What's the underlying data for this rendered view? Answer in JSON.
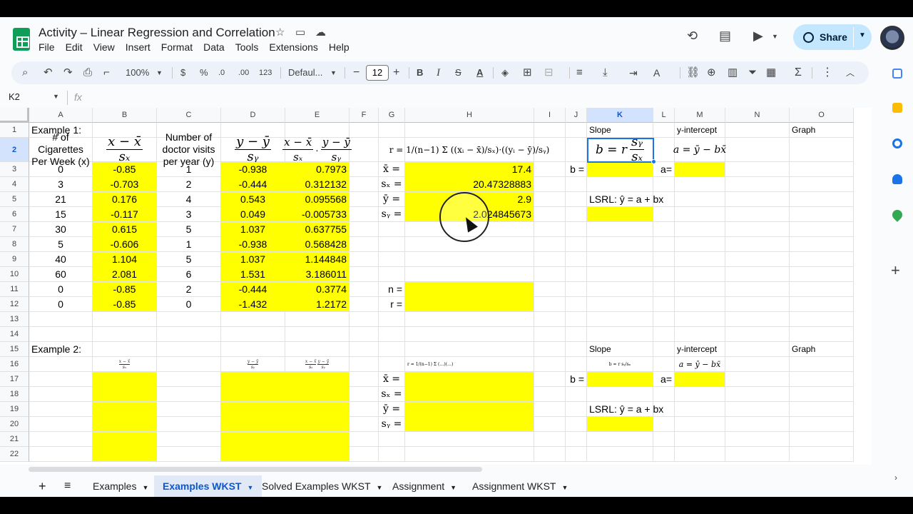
{
  "app": {
    "title": "Activity – Linear Regression and Correlation",
    "menus": [
      "File",
      "Edit",
      "View",
      "Insert",
      "Format",
      "Data",
      "Tools",
      "Extensions",
      "Help"
    ],
    "share_label": "Share"
  },
  "toolbar": {
    "zoom": "100%",
    "currency": "$",
    "percent": "%",
    "decrease_decimal": ".0",
    "increase_decimal": ".00",
    "number_format": "123",
    "font": "Defaul...",
    "font_size": "12"
  },
  "formula_bar": {
    "cell_ref": "K2",
    "fx": "fx",
    "content": ""
  },
  "grid": {
    "columns": [
      "A",
      "B",
      "C",
      "D",
      "E",
      "F",
      "G",
      "H",
      "I",
      "J",
      "K",
      "L",
      "M",
      "N",
      "O"
    ],
    "rows": [
      "1",
      "2",
      "3",
      "4",
      "5",
      "6",
      "7",
      "8",
      "9",
      "10",
      "11",
      "12",
      "13",
      "14",
      "15",
      "16",
      "17",
      "18",
      "19",
      "20",
      "21",
      "22"
    ],
    "selected_col": "K",
    "selected_row": "2",
    "example1": {
      "label": "Example 1:",
      "header_x": "# of Cigarettes Per Week (x)",
      "header_zx_num": "x − x̄",
      "header_zx_den": "sₓ",
      "header_y": "Number of doctor visits per year (y)",
      "header_zy_num": "y − ȳ",
      "header_zy_den": "sᵧ",
      "header_prod_a_num": "x − x̄",
      "header_prod_a_den": "sₓ",
      "header_prod_b_num": "y − ȳ",
      "header_prod_b_den": "sᵧ",
      "r_formula": "r = 1/(n−1) Σ ((xᵢ − x̄)/sₓ)·((yᵢ − ȳ)/sᵧ)",
      "table": [
        [
          "0",
          "-0.85",
          "1",
          "-0.938",
          "0.7973"
        ],
        [
          "3",
          "-0.703",
          "2",
          "-0.444",
          "0.312132"
        ],
        [
          "21",
          "0.176",
          "4",
          "0.543",
          "0.095568"
        ],
        [
          "15",
          "-0.117",
          "3",
          "0.049",
          "-0.005733"
        ],
        [
          "30",
          "0.615",
          "5",
          "1.037",
          "0.637755"
        ],
        [
          "5",
          "-0.606",
          "1",
          "-0.938",
          "0.568428"
        ],
        [
          "40",
          "1.104",
          "5",
          "1.037",
          "1.144848"
        ],
        [
          "60",
          "2.081",
          "6",
          "1.531",
          "3.186011"
        ],
        [
          "0",
          "-0.85",
          "2",
          "-0.444",
          "0.3774"
        ],
        [
          "0",
          "-0.85",
          "0",
          "-1.432",
          "1.2172"
        ]
      ],
      "stats_labels": [
        "x̄ =",
        "sₓ =",
        "ȳ =",
        "sᵧ ="
      ],
      "stats_values": [
        "17.4",
        "20.47328883",
        "2.9",
        "2.024845673"
      ],
      "n_label": "n =",
      "r_label": "r =",
      "slope_label": "Slope",
      "intercept_label": "y-intercept",
      "graph_label": "Graph",
      "slope_formula_lhs": "b = r",
      "slope_formula_num": "sᵧ",
      "slope_formula_den": "sₓ",
      "intercept_formula": "a = ȳ − bx̄",
      "b_label": "b =",
      "a_label": "a=",
      "lsrl": "LSRL: ŷ = a + bx"
    },
    "example2": {
      "label": "Example 2:",
      "slope_label": "Slope",
      "intercept_label": "y-intercept",
      "graph_label": "Graph",
      "intercept_formula": "a = ȳ − bx̄",
      "stats_labels": [
        "x̄ =",
        "sₓ =",
        "ȳ =",
        "sᵧ ="
      ],
      "b_label": "b =",
      "a_label": "a=",
      "lsrl": "LSRL: ŷ = a + bx",
      "mini_zx_num": "x − x̄",
      "mini_zx_den": "sₓ",
      "mini_zy_num": "y − ȳ",
      "mini_zy_den": "sᵧ",
      "mini_slope": "b = r sᵧ/sₓ",
      "mini_r": "r = 1/(n−1) Σ (…)(…)"
    }
  },
  "sheet_tabs": [
    "Examples",
    "Examples WKST",
    "Solved Examples WKST",
    "Assignment",
    "Assignment WKST"
  ],
  "active_tab": "Examples WKST",
  "colors": {
    "highlight": "#ffff00",
    "selection": "#1a73e8",
    "share_bg": "#c2e7ff",
    "sheets_green": "#0f9d58"
  }
}
